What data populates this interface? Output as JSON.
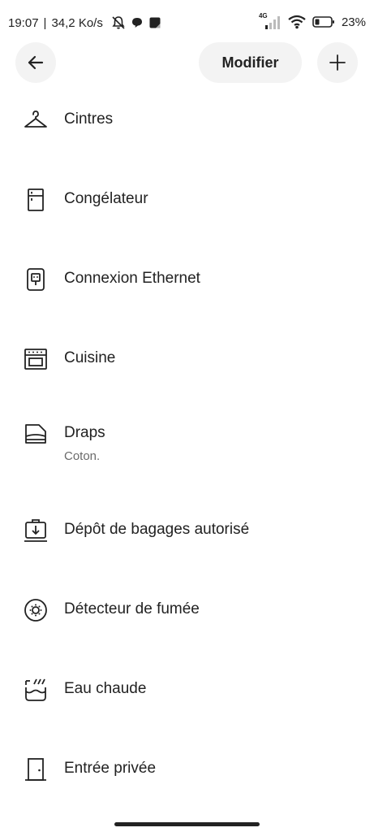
{
  "status_bar": {
    "time": "19:07",
    "separator": "|",
    "speed": "34,2 Ko/s",
    "network": "4G",
    "battery": "23%"
  },
  "top_bar": {
    "modify_label": "Modifier"
  },
  "amenities": [
    {
      "label": "Cintres",
      "sublabel": "",
      "icon": "hanger-icon"
    },
    {
      "label": "Congélateur",
      "sublabel": "",
      "icon": "freezer-icon"
    },
    {
      "label": "Connexion Ethernet",
      "sublabel": "",
      "icon": "ethernet-icon"
    },
    {
      "label": "Cuisine",
      "sublabel": "",
      "icon": "oven-icon"
    },
    {
      "label": "Draps",
      "sublabel": "Coton.",
      "icon": "bed-sheets-icon"
    },
    {
      "label": "Dépôt de bagages autorisé",
      "sublabel": "",
      "icon": "luggage-dropoff-icon"
    },
    {
      "label": "Détecteur de fumée",
      "sublabel": "",
      "icon": "smoke-detector-icon"
    },
    {
      "label": "Eau chaude",
      "sublabel": "",
      "icon": "hot-water-icon"
    },
    {
      "label": "Entrée privée",
      "sublabel": "",
      "icon": "door-icon"
    }
  ]
}
